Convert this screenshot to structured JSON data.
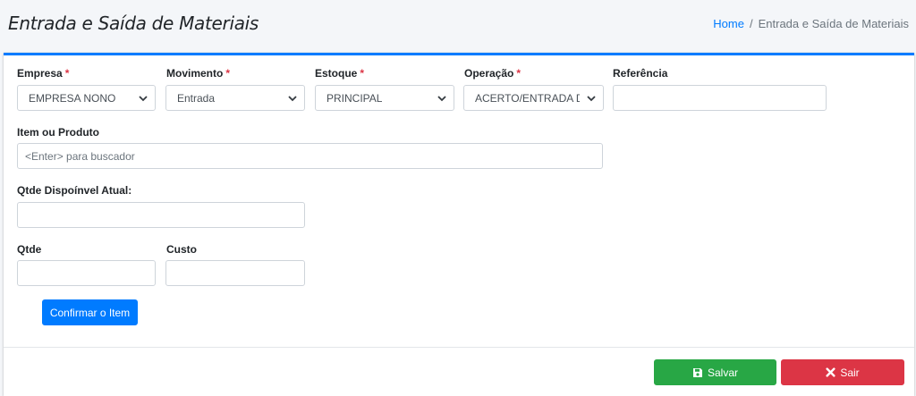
{
  "header": {
    "title": "Entrada e Saída de Materiais",
    "breadcrumb": {
      "home": "Home",
      "separator": "/",
      "current": "Entrada e Saída de Materiais"
    }
  },
  "form": {
    "required_marker": "*",
    "empresa": {
      "label": "Empresa",
      "value": "EMPRESA NONO"
    },
    "movimento": {
      "label": "Movimento",
      "value": "Entrada"
    },
    "estoque": {
      "label": "Estoque",
      "value": "PRINCIPAL"
    },
    "operacao": {
      "label": "Operação",
      "value": "ACERTO/ENTRADA DO E"
    },
    "referencia": {
      "label": "Referência",
      "value": ""
    },
    "item": {
      "label": "Item ou Produto",
      "placeholder": "<Enter> para buscador"
    },
    "qtde_disponivel": {
      "label": "Qtde Dispoínvel Atual:",
      "value": ""
    },
    "qtde": {
      "label": "Qtde",
      "value": ""
    },
    "custo": {
      "label": "Custo",
      "value": ""
    },
    "confirm_button": "Confirmar o Item"
  },
  "footer": {
    "save_button": "Salvar",
    "exit_button": "Sair"
  },
  "colors": {
    "primary": "#007bff",
    "success": "#28a745",
    "danger": "#dc3545",
    "required": "#dc3545"
  },
  "icons": [
    "chevron-down-icon",
    "save-icon",
    "close-icon"
  ]
}
